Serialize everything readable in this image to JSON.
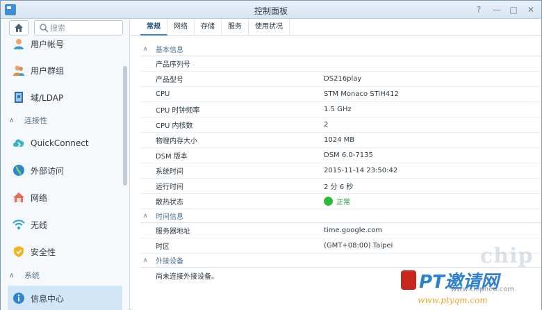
{
  "window": {
    "title": "控制面板",
    "controls": [
      "?",
      "—",
      "□",
      "✕"
    ]
  },
  "sidebar": {
    "search_placeholder": "搜索",
    "items": [
      {
        "label": "用户帐号",
        "icon": "user-icon"
      },
      {
        "label": "用户群组",
        "icon": "user-group-icon"
      },
      {
        "label": "域/LDAP",
        "icon": "domain-ldap-icon"
      },
      {
        "section": "连接性"
      },
      {
        "label": "QuickConnect",
        "icon": "quickconnect-icon"
      },
      {
        "label": "外部访问",
        "icon": "globe-icon"
      },
      {
        "label": "网络",
        "icon": "network-icon"
      },
      {
        "label": "无线",
        "icon": "wifi-icon"
      },
      {
        "label": "安全性",
        "icon": "shield-icon"
      },
      {
        "section": "系统"
      },
      {
        "label": "信息中心",
        "icon": "info-icon",
        "active": true
      }
    ]
  },
  "tabs": [
    "常规",
    "网络",
    "存储",
    "服务",
    "使用状况"
  ],
  "active_tab": "常规",
  "groups": {
    "basic": {
      "title": "基本信息",
      "rows": [
        {
          "key": "产品序列号",
          "value": ""
        },
        {
          "key": "产品型号",
          "value": "DS216play"
        },
        {
          "key": "CPU",
          "value": "STM Monaco STiH412"
        },
        {
          "key": "CPU 时钟频率",
          "value": "1.5 GHz"
        },
        {
          "key": "CPU 内核数",
          "value": "2"
        },
        {
          "key": "物理内存大小",
          "value": "1024 MB"
        },
        {
          "key": "DSM 版本",
          "value": "DSM 6.0-7135"
        },
        {
          "key": "系统时间",
          "value": "2015-11-14 23:50:42"
        },
        {
          "key": "运行时间",
          "value": "2 分 6 秒"
        },
        {
          "key": "散热状态",
          "value": "正常",
          "status_color": "#2dbb3b"
        }
      ]
    },
    "time": {
      "title": "时间信息",
      "rows": [
        {
          "key": "服务器地址",
          "value": "time.google.com"
        },
        {
          "key": "时区",
          "value": "(GMT+08:00) Taipei"
        }
      ]
    },
    "external": {
      "title": "外接设备",
      "note": "尚未连接外接设备。"
    }
  },
  "watermark": {
    "chip": "chip",
    "main": "PT邀请网",
    "sub1": "www.chipneu.com",
    "sub2": "www.ptyqm.com"
  }
}
